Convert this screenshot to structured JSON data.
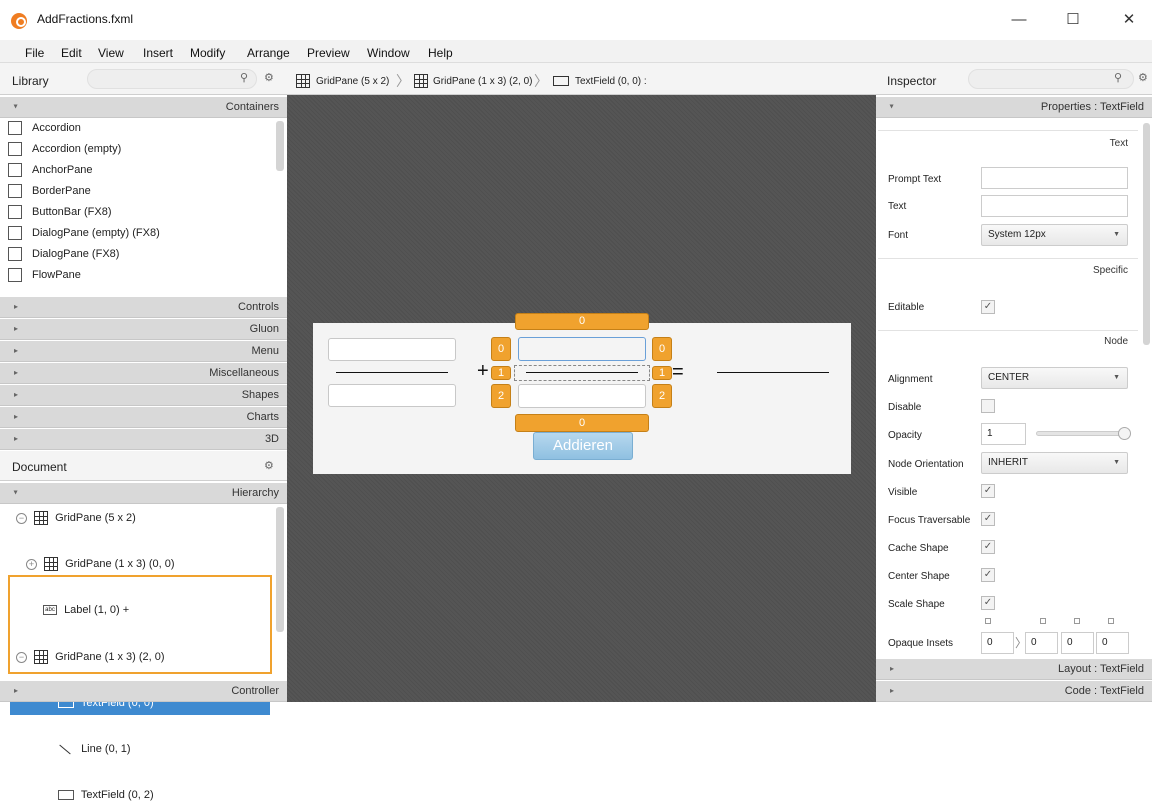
{
  "window": {
    "title": "AddFractions.fxml",
    "minimize": "—",
    "maximize": "☐",
    "close": "✕"
  },
  "menu": [
    "File",
    "Edit",
    "View",
    "Insert",
    "Modify",
    "Arrange",
    "Preview",
    "Window",
    "Help"
  ],
  "library": {
    "title": "Library",
    "search_icon": "search-icon",
    "sections": {
      "containers": "Containers",
      "controls": "Controls",
      "gluon": "Gluon",
      "menu": "Menu",
      "misc": "Miscellaneous",
      "shapes": "Shapes",
      "charts": "Charts",
      "3d": "3D"
    },
    "items": [
      "Accordion",
      "Accordion  (empty)",
      "AnchorPane",
      "BorderPane",
      "ButtonBar  (FX8)",
      "DialogPane (empty)  (FX8)",
      "DialogPane  (FX8)",
      "FlowPane"
    ]
  },
  "document": {
    "title": "Document",
    "hierarchy": "Hierarchy",
    "controller": "Controller",
    "tree": [
      "GridPane (5 x 2)",
      "GridPane (1 x 3) (0, 0)",
      "Label (1, 0)  +",
      "GridPane (1 x 3) (2, 0)",
      "TextField (0, 0)",
      "Line (0, 1)",
      "TextField (0, 2)"
    ]
  },
  "breadcrumb": [
    "GridPane (5 x 2)",
    "GridPane (1 x 3) (2, 0)",
    "TextField (0, 0) :"
  ],
  "stage": {
    "plus": "+",
    "equals": "=",
    "col_index": "0",
    "row_indices": [
      "0",
      "1",
      "2"
    ],
    "bottom_index": "0",
    "button": "Addieren"
  },
  "inspector": {
    "title": "Inspector",
    "properties_header": "Properties : TextField",
    "section_text": "Text",
    "prompt_text_label": "Prompt Text",
    "text_label": "Text",
    "font_label": "Font",
    "font_value": "System 12px",
    "section_specific": "Specific",
    "editable_label": "Editable",
    "section_node": "Node",
    "alignment_label": "Alignment",
    "alignment_value": "CENTER",
    "disable_label": "Disable",
    "opacity_label": "Opacity",
    "opacity_value": "1",
    "node_orientation_label": "Node Orientation",
    "node_orientation_value": "INHERIT",
    "visible_label": "Visible",
    "focus_label": "Focus Traversable",
    "cache_label": "Cache Shape",
    "center_label": "Center Shape",
    "scale_label": "Scale Shape",
    "opaque_label": "Opaque Insets",
    "opaque_values": [
      "0",
      "0",
      "0",
      "0"
    ],
    "layout_header": "Layout : TextField",
    "code_header": "Code : TextField"
  }
}
